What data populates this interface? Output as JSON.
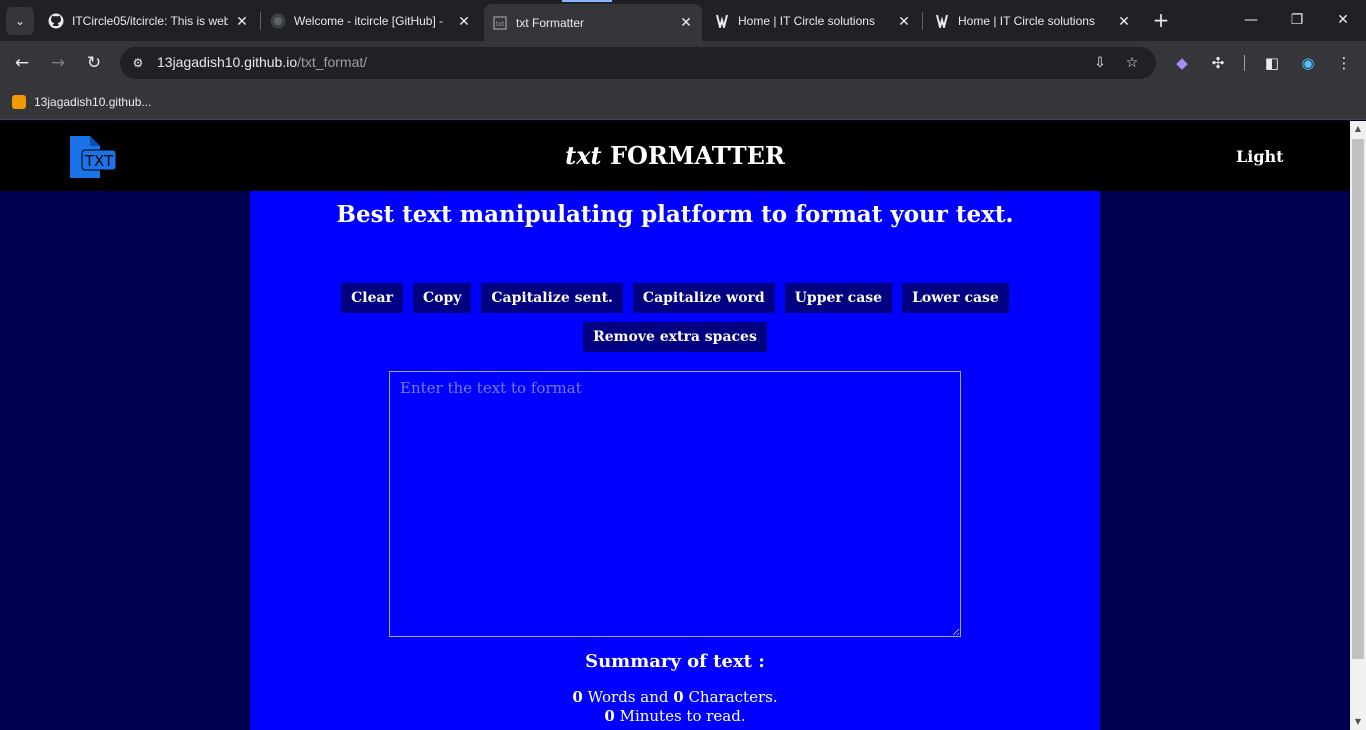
{
  "browser": {
    "tabs": [
      {
        "title": "ITCircle05/itcircle: This is web",
        "icon": "github-icon"
      },
      {
        "title": "Welcome - itcircle [GitHub] - ",
        "icon": "github-icon"
      },
      {
        "title": "txt Formatter",
        "icon": "txt-icon"
      },
      {
        "title": "Home | IT Circle solutions",
        "icon": "itcircle-icon"
      },
      {
        "title": "Home | IT Circle solutions",
        "icon": "itcircle-icon"
      }
    ],
    "active_tab": 2,
    "url_host": "13jagadish10.github.io",
    "url_path": "/txt_format/",
    "bookmark": "13jagadish10.github..."
  },
  "page": {
    "brand_italic": "txt",
    "brand_rest": " FORMATTER",
    "mode_toggle": "Light",
    "headline": "Best text manipulating platform to format your text.",
    "buttons_row1": [
      "Clear",
      "Copy",
      "Capitalize sent.",
      "Capitalize word",
      "Upper case",
      "Lower case"
    ],
    "buttons_row2": [
      "Remove extra spaces"
    ],
    "textarea_placeholder": "Enter the text to format",
    "summary_title": "Summary of text :",
    "words": "0",
    "words_label": " Words and ",
    "chars": "0",
    "chars_label": " Characters.",
    "minutes": "0",
    "minutes_label": " Minutes to read."
  },
  "colors": {
    "page_bg": "#000050",
    "main_bg": "#0000ff",
    "button_bg": "#000080",
    "navbar_bg": "#000000",
    "logo_blue": "#1a73e8"
  }
}
